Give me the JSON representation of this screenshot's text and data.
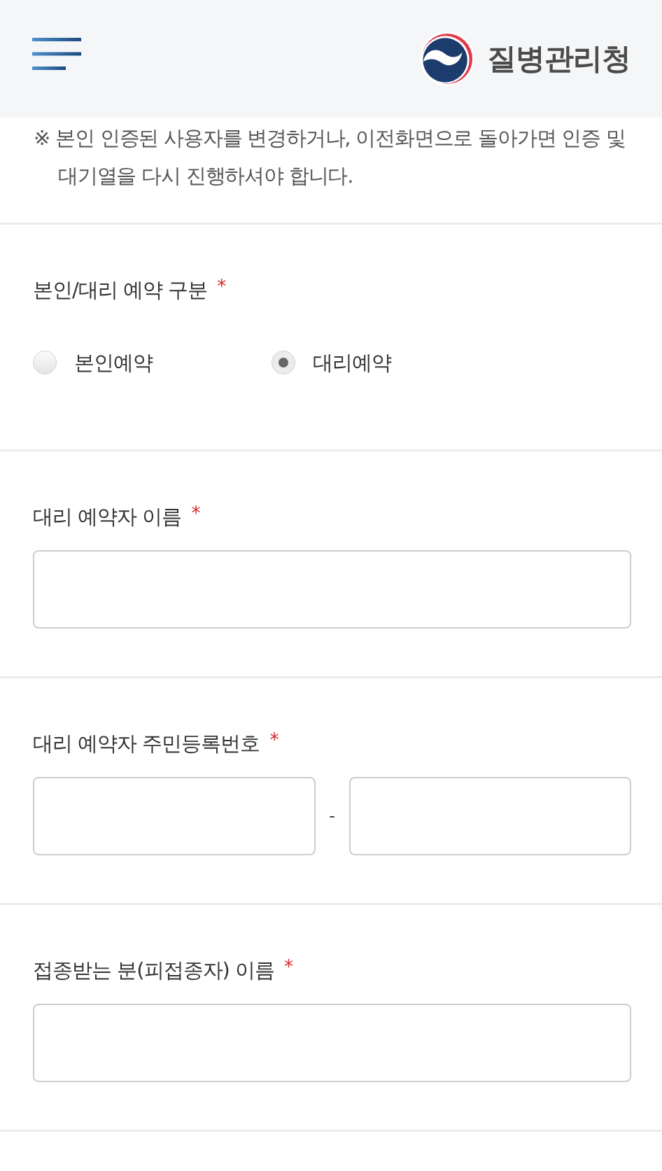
{
  "header": {
    "logo_text": "질병관리청"
  },
  "notice": {
    "text": "※ 본인 인증된 사용자를 변경하거나, 이전화면으로 돌아가면 인증 및 대기열을 다시 진행하셔야 합니다."
  },
  "fields": [
    {
      "kind": "radio",
      "label": "본인/대리 예약 구분",
      "required_mark": "*",
      "options": [
        {
          "label": "본인예약",
          "selected": false
        },
        {
          "label": "대리예약",
          "selected": true
        }
      ]
    },
    {
      "kind": "text",
      "label": "대리 예약자 이름",
      "required_mark": "*"
    },
    {
      "kind": "split",
      "label": "대리 예약자 주민등록번호",
      "required_mark": "*",
      "separator": "-"
    },
    {
      "kind": "text",
      "label": "접종받는 분(피접종자) 이름",
      "required_mark": "*"
    }
  ]
}
